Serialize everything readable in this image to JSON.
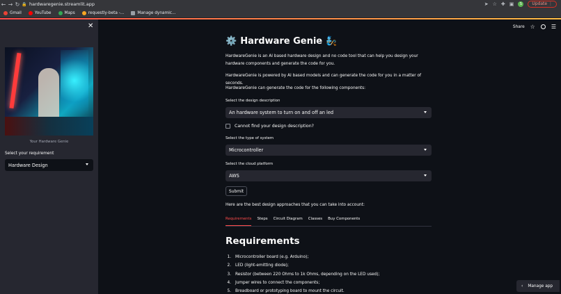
{
  "browser": {
    "url": "hardwaregenie.streamlit.app",
    "update_label": "Update",
    "profile_initial": "S",
    "bookmarks": [
      {
        "label": "Gmail",
        "color": "#ea4335"
      },
      {
        "label": "YouTube",
        "color": "#ff0000"
      },
      {
        "label": "Maps",
        "color": "#34a853"
      },
      {
        "label": "requestly-beta -...",
        "color": "#f6a623"
      },
      {
        "label": "Manage dynamic...",
        "color": "#5f6368"
      }
    ]
  },
  "sidebar": {
    "image_caption": "Your Hardware Genie",
    "requirement_label": "Select your requirement",
    "requirement_value": "Hardware Design"
  },
  "header": {
    "share_label": "Share"
  },
  "main": {
    "title": "Hardware Genie",
    "title_icon": "⚙️",
    "title_emoji": "🧞",
    "intro1": "HardwareGenie is an AI based hardware design and no code tool that can help you design your hardware components and generate the code for you.",
    "intro2": "HardwareGenie is powered by AI based models and can generate the code for you in a matter of seconds.",
    "intro3": "HardwareGenie can generate the code for the following components:",
    "design_label": "Select the design description",
    "design_value": "An hardware system to turn on and off an led",
    "checkbox_label": "Cannot find your design description?",
    "system_label": "Select the type of system",
    "system_value": "Microcontroller",
    "cloud_label": "Select the cloud platform",
    "cloud_value": "AWS",
    "submit_label": "Submit",
    "approaches_text": "Here are the best design approaches that you can take into account:",
    "tabs": [
      "Requirements",
      "Steps",
      "Circuit Diagram",
      "Classes",
      "Buy Components"
    ],
    "active_tab": "Requirements",
    "section_heading": "Requirements",
    "requirements": [
      {
        "num": "1.",
        "text": "Microcontroller board (e.g. Arduino);"
      },
      {
        "num": "2.",
        "text": "LED (light-emitting diode);"
      },
      {
        "num": "3.",
        "text": "Resistor (between 220 Ohms to 1k Ohms, depending on the LED used);"
      },
      {
        "num": "4.",
        "text": "Jumper wires to connect the components;"
      },
      {
        "num": "5.",
        "text": "Breadboard or prototyping board to mount the circuit."
      }
    ]
  },
  "footer": {
    "manage_label": "Manage app"
  },
  "colors": {
    "accent": "#ff4b4b",
    "background": "#0e1117",
    "sidebar": "#262730"
  }
}
